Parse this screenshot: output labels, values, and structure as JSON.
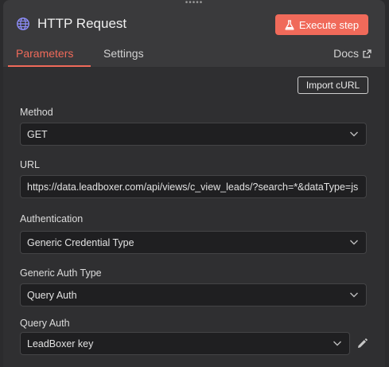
{
  "header": {
    "title": "HTTP Request",
    "execute_label": "Execute step",
    "node_icon": "globe-icon"
  },
  "tabs": [
    {
      "label": "Parameters",
      "active": true
    },
    {
      "label": "Settings",
      "active": false
    }
  ],
  "docs_label": "Docs",
  "import_curl_label": "Import cURL",
  "fields": {
    "method": {
      "label": "Method",
      "value": "GET"
    },
    "url": {
      "label": "URL",
      "value": "https://data.leadboxer.com/api/views/c_view_leads/?search=*&dataType=js"
    },
    "authentication": {
      "label": "Authentication",
      "value": "Generic Credential Type"
    },
    "generic_auth_type": {
      "label": "Generic Auth Type",
      "value": "Query Auth"
    },
    "query_auth": {
      "label": "Query Auth",
      "value": "LeadBoxer key"
    }
  },
  "colors": {
    "accent": "#f06a5a",
    "panel": "#3a3a3c",
    "content": "#2f2f31",
    "input": "#1f1f21"
  }
}
